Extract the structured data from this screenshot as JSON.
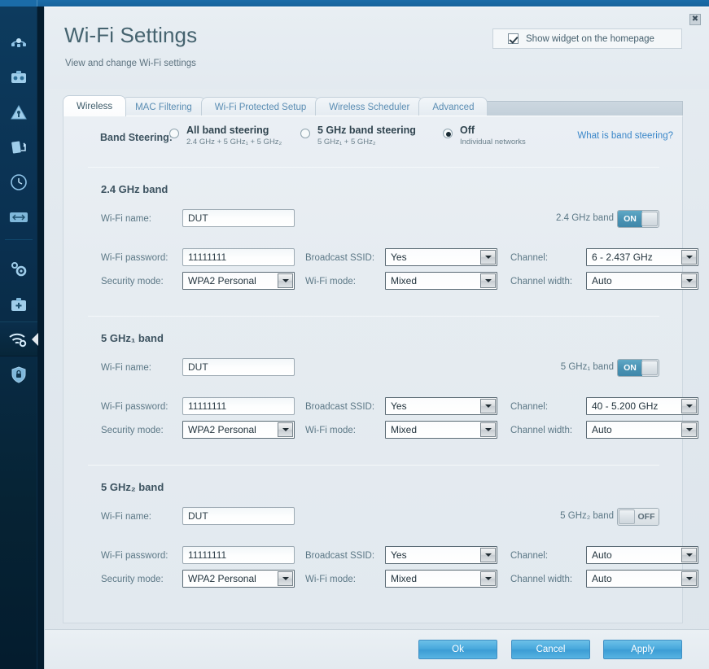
{
  "window": {
    "close_label": "✖"
  },
  "sidebar": {
    "items": [
      {
        "name": "network-map-icon",
        "selected": false
      },
      {
        "name": "media-prioritization-icon",
        "selected": false
      },
      {
        "name": "parental-controls-icon",
        "selected": false
      },
      {
        "name": "usb-storage-icon",
        "selected": false
      },
      {
        "name": "speed-test-icon",
        "selected": false
      },
      {
        "name": "connectivity-icon",
        "selected": false
      },
      {
        "name": "router-settings-icon",
        "selected": false
      },
      {
        "name": "troubleshooting-icon",
        "selected": false
      },
      {
        "name": "wifi-settings-icon",
        "selected": true
      },
      {
        "name": "security-icon",
        "selected": false
      }
    ]
  },
  "header": {
    "title": "Wi-Fi Settings",
    "subtitle": "View and change Wi-Fi settings",
    "widget_checkbox_label": "Show widget on the homepage",
    "widget_checked": true
  },
  "tabs": [
    {
      "label": "Wireless",
      "active": true
    },
    {
      "label": "MAC Filtering",
      "active": false
    },
    {
      "label": "Wi-Fi Protected Setup",
      "active": false
    },
    {
      "label": "Wireless Scheduler",
      "active": false
    },
    {
      "label": "Advanced",
      "active": false
    }
  ],
  "band_steering": {
    "label": "Band Steering:",
    "options": [
      {
        "title": "All band steering",
        "sub": "2.4 GHz + 5 GHz₁ + 5 GHz₂",
        "selected": false
      },
      {
        "title": "5 GHz band steering",
        "sub": "5 GHz₁ + 5 GHz₂",
        "selected": false
      },
      {
        "title": "Off",
        "sub": "Individual networks",
        "selected": true
      }
    ],
    "help_link": "What is band steering?"
  },
  "labels": {
    "wifi_name": "Wi-Fi name:",
    "wifi_password": "Wi-Fi password:",
    "security_mode": "Security mode:",
    "broadcast_ssid": "Broadcast SSID:",
    "wifi_mode": "Wi-Fi mode:",
    "channel": "Channel:",
    "channel_width": "Channel width:"
  },
  "bands": [
    {
      "title": "2.4 GHz band",
      "toggle_label": "2.4 GHz band",
      "toggle_state": "ON",
      "toggle_on": true,
      "wifi_name": "DUT",
      "wifi_password": "11111111",
      "security_mode": "WPA2 Personal",
      "broadcast_ssid": "Yes",
      "wifi_mode": "Mixed",
      "channel": "6 - 2.437 GHz",
      "channel_width": "Auto"
    },
    {
      "title": "5 GHz₁ band",
      "toggle_label": "5 GHz₁ band",
      "toggle_state": "ON",
      "toggle_on": true,
      "wifi_name": "DUT",
      "wifi_password": "11111111",
      "security_mode": "WPA2 Personal",
      "broadcast_ssid": "Yes",
      "wifi_mode": "Mixed",
      "channel": "40 - 5.200 GHz",
      "channel_width": "Auto"
    },
    {
      "title": "5 GHz₂ band",
      "toggle_label": "5 GHz₂ band",
      "toggle_state": "OFF",
      "toggle_on": false,
      "wifi_name": "DUT",
      "wifi_password": "11111111",
      "security_mode": "WPA2 Personal",
      "broadcast_ssid": "Yes",
      "wifi_mode": "Mixed",
      "channel": "Auto",
      "channel_width": "Auto"
    }
  ],
  "footer": {
    "ok": "Ok",
    "cancel": "Cancel",
    "apply": "Apply"
  },
  "colors": {
    "accent_blue": "#3b9cd4",
    "link_blue": "#3b87c9",
    "toggle_on": "#4a93b4",
    "sidebar_dark": "#041c2e",
    "title_text": "#45636f"
  }
}
